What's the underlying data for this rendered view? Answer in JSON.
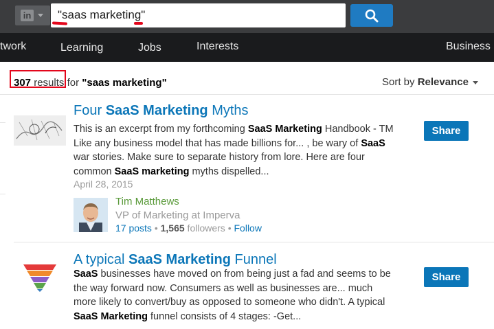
{
  "topbar": {
    "logo_text": "in",
    "search_value": "\"saas marketing\"",
    "clear_symbol": "×"
  },
  "nav": {
    "items": [
      "twork",
      "Learning",
      "Jobs",
      "Interests",
      "Business"
    ]
  },
  "results_header": {
    "count": "307",
    "results_word": "results",
    "for_word": "for",
    "query": "\"saas marketing\"",
    "sort_label": "Sort by",
    "sort_value": "Relevance"
  },
  "results": [
    {
      "title_pre": "Four ",
      "title_bold": "SaaS Marketing",
      "title_post": " Myths",
      "snippet_parts": [
        [
          "This is an excerpt from my forthcoming ",
          false
        ],
        [
          "SaaS Marketing",
          true
        ],
        [
          " Handbook - TM Like any business model that has made billions for... , be wary of ",
          false
        ],
        [
          "SaaS",
          true
        ],
        [
          " war stories. Make sure to separate history from lore. Here are four common ",
          false
        ],
        [
          "SaaS marketing",
          true
        ],
        [
          " myths dispelled...",
          false
        ]
      ],
      "date": "April 28, 2015",
      "share_label": "Share",
      "author": {
        "name": "Tim Matthews",
        "title": "VP of Marketing at Imperva",
        "posts": "17 posts",
        "sep1": " • ",
        "followers_count": "1,565",
        "followers_word": " followers",
        "sep2": " • ",
        "follow_label": "Follow"
      }
    },
    {
      "title_pre": "A typical ",
      "title_bold": "SaaS Marketing",
      "title_post": " Funnel",
      "snippet_parts": [
        [
          "SaaS",
          true
        ],
        [
          " businesses have moved on from being just a fad and seems to be the way forward now. Consumers as well as businesses are... much more likely to convert/buy as opposed to someone who didn't. A typical ",
          false
        ],
        [
          "SaaS Marketing",
          true
        ],
        [
          " funnel consists of 4 stages: -Get...",
          false
        ]
      ],
      "share_label": "Share"
    }
  ],
  "colors": {
    "link_blue": "#0b76b8",
    "highlight_red": "#e3061b",
    "author_green": "#5a9a3a",
    "topbar_bg": "#3b3c3e",
    "nav_bg": "#1a1b1d"
  }
}
